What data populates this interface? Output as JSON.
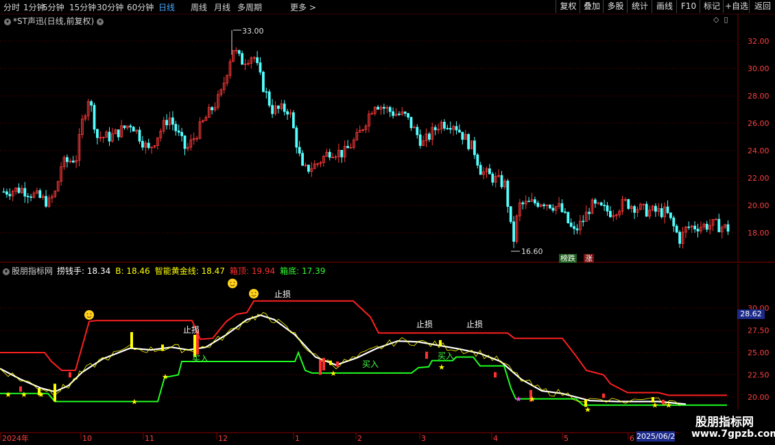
{
  "toolbar": {
    "periods": [
      "分时",
      "1分钟",
      "5分钟",
      "15分钟",
      "30分钟",
      "60分钟",
      "日线",
      "周线",
      "月线",
      "多周期"
    ],
    "more": "更多 >",
    "active_period": "日线",
    "right_buttons": [
      "复权",
      "叠加",
      "多股",
      "统计",
      "画线",
      "F10",
      "标记",
      "+自选",
      "返回"
    ]
  },
  "main_chart": {
    "title": "*ST声迅(日线,前复权)",
    "y_ticks": [
      "32.00",
      "30.00",
      "28.00",
      "26.00",
      "24.00",
      "22.00",
      "20.00",
      "18.00"
    ],
    "high_label": "33.00",
    "low_label": "16.60",
    "badge_bang": "榜跌",
    "badge_zhang": "涨"
  },
  "indicator": {
    "name": "股朋指标网",
    "values": [
      {
        "label": "捞钱手: 18.34",
        "color": "#ffffff"
      },
      {
        "label": "B: 18.46",
        "color": "#ffff00"
      },
      {
        "label": "智能黄金线: 18.47",
        "color": "#ffff00"
      },
      {
        "label": "箱顶: 19.94",
        "color": "#ff3030"
      },
      {
        "label": "箱底: 17.39",
        "color": "#30ff30"
      }
    ],
    "y_ticks": [
      "30.00",
      "27.50",
      "25.00",
      "22.50",
      "20.00"
    ],
    "current_value": "28.62",
    "stop_loss_label": "止损",
    "buy_label": "买入"
  },
  "x_axis": {
    "labels": [
      "2024年",
      "10",
      "11",
      "12",
      "1",
      "2",
      "3",
      "4",
      "5",
      "6"
    ],
    "current_date": "2025/06/2"
  },
  "watermark": {
    "line1": "股朋指标网",
    "line2": "www.7gpzb.com"
  },
  "colors": {
    "up": "#ff3a3a",
    "down": "#54ffff",
    "grid": "#7a0000",
    "box_top": "#ff2020",
    "box_bottom": "#20ff20",
    "golden": "#ffff00"
  },
  "chart_data": {
    "type": "candlestick",
    "y_range": [
      16.6,
      33.0
    ],
    "high": 33.0,
    "low": 16.6,
    "last_close": 18.34,
    "indicator_series": {
      "捞钱手": 18.34,
      "B": 18.46,
      "智能黄金线": 18.47,
      "箱顶": 19.94,
      "箱底": 17.39
    }
  }
}
